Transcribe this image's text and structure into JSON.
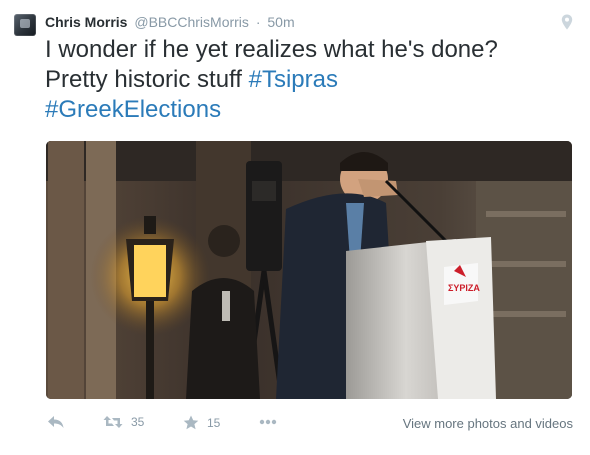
{
  "tweet": {
    "author_name": "Chris Morris",
    "author_handle": "@BBCChrisMorris",
    "separator": "·",
    "time": "50m",
    "text_line1": "I wonder if he yet realizes what he's done?",
    "text_line2_plain": "Pretty historic stuff ",
    "hashtag1": "#Tsipras",
    "hashtag2": "#GreekElections",
    "hashtag_color": "#2b7bb9"
  },
  "photo": {
    "sign_text": "ΣΥΡΙΖΑ"
  },
  "actions": {
    "reply_icon": "reply-icon",
    "retweet_icon": "retweet-icon",
    "retweet_count": "35",
    "favorite_icon": "star-icon",
    "favorite_count": "15",
    "more_icon": "more-icon",
    "view_more_label": "View more photos and videos"
  }
}
